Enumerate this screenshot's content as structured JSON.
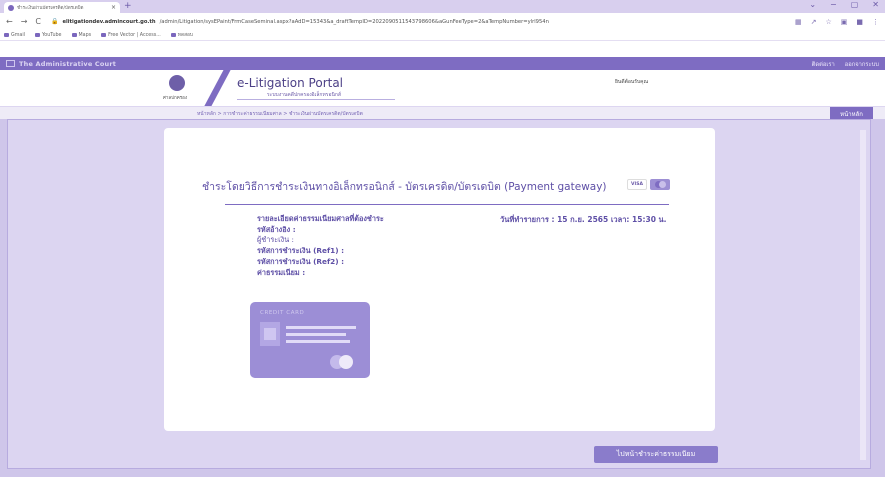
{
  "browser": {
    "tab_title": "ชำระเงินผ่านบัตรเครดิต/บัตรเดบิต",
    "tab_close": "×",
    "new_tab": "+",
    "window_controls": [
      "⌄",
      "−",
      "▢",
      "✕"
    ],
    "back": "←",
    "forward": "→",
    "reload": "C",
    "url_host": "elitigationdev.admincourt.go.th",
    "url_path": "/admin/Litigation/sysEPaint/FrmCaseSeminal.aspx?aAdD=15343&a_draftTempID=2022090511543798606&aGunFeeType=2&aTempNumber=ylrl954n",
    "bookmarks": [
      "Gmail",
      "YouTube",
      "Maps",
      "Free Vector | Access...",
      "ทดสอบ"
    ]
  },
  "court": {
    "name": "The Administrative Court",
    "right_items": [
      "ติดต่อเรา",
      "ออกจากระบบ"
    ]
  },
  "portal": {
    "seal_label": "ศาลปกครอง",
    "title": "e-Litigation Portal",
    "subtitle": "ระบบงานคดีปกครองอิเล็กทรอนิกส์",
    "welcome": "ยินดีต้อนรับคุณ"
  },
  "breadcrumb": {
    "text": "หน้าหลัก  >  การชำระค่าธรรมเนียมศาล  >  ชำระเงินผ่านบัตรเครดิต/บัตรเดบิต",
    "home_button": "หน้าหลัก"
  },
  "payment": {
    "title": "ชำระโดยวิธีการชำระเงินทางอิเล็กทรอนิกส์ - บัตรเครดิต/บัตรเดบิต (Payment gateway)",
    "visa": "VISA",
    "mastercard": "mastercard",
    "details_heading": "รายละเอียดค่าธรรมเนียมศาลที่ต้องชำระ",
    "ref_label": "รหัสอ้างอิง :",
    "payer_label": "ผู้ชำระเงิน :",
    "ref1_label": "รหัสการชำระเงิน (Ref1) :",
    "ref2_label": "รหัสการชำระเงิน (Ref2) :",
    "fee_label": "ค่าธรรมเนียม :",
    "transaction_date": "วันที่ทำรายการ : 15 ก.ย. 2565 เวลา: 15:30 น.",
    "card_label": "CREDIT CARD",
    "go_pay_button": "ไปหน้าชำระค่าธรรมเนียม"
  }
}
